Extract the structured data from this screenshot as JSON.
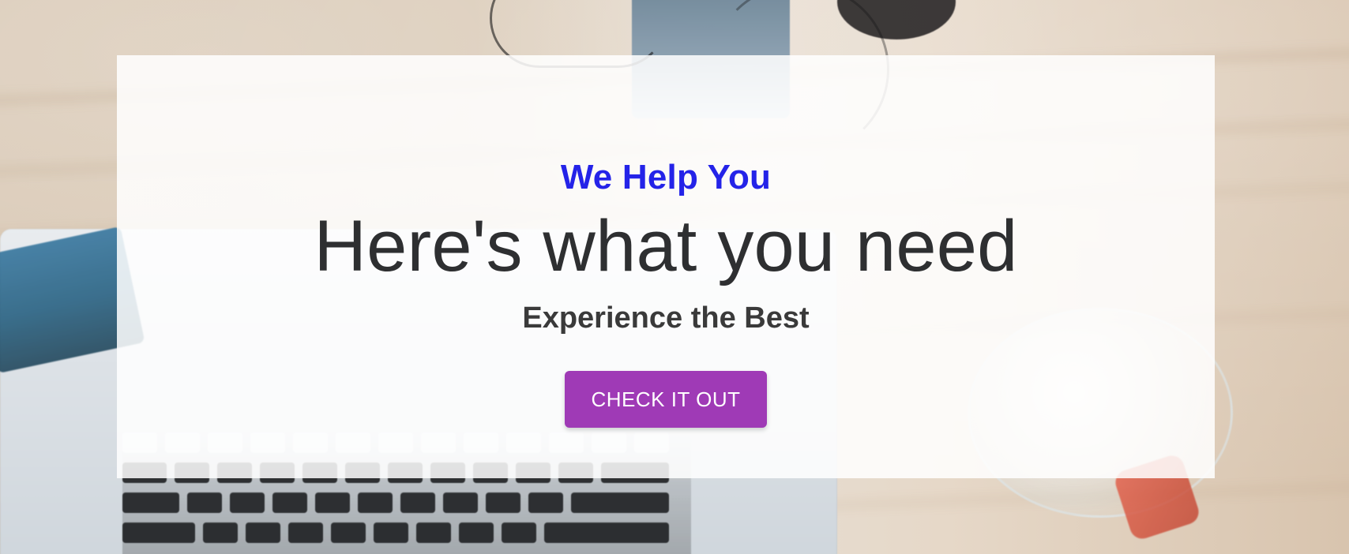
{
  "hero": {
    "kicker": "We Help You",
    "headline": "Here's what you need",
    "subhead": "Experience the Best",
    "cta_label": "CHECK IT OUT"
  },
  "colors": {
    "kicker": "#2423e8",
    "headline": "#2e2f31",
    "subhead": "#3a3a3a",
    "cta_background": "#9f3ab6",
    "cta_text": "#ffffff",
    "overlay": "rgba(255,255,255,0.86)"
  }
}
